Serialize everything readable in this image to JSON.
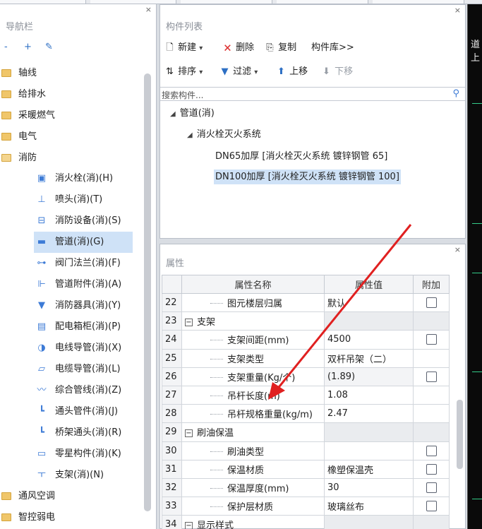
{
  "nav": {
    "title": "导航栏",
    "close": "×",
    "toolbar": [
      "-",
      "+",
      "✎"
    ],
    "categories": [
      {
        "label": "轴线"
      },
      {
        "label": "给排水"
      },
      {
        "label": "采暖燃气"
      },
      {
        "label": "电气"
      },
      {
        "label": "消防"
      }
    ],
    "fire_items": [
      {
        "label": "消火栓(消)(H)",
        "icon": "hydrant-icon",
        "glyph": "▣"
      },
      {
        "label": "喷头(消)(T)",
        "icon": "sprinkler-icon",
        "glyph": "⊥"
      },
      {
        "label": "消防设备(消)(S)",
        "icon": "fire-equipment-icon",
        "glyph": "⊟"
      },
      {
        "label": "管道(消)(G)",
        "icon": "pipe-icon",
        "glyph": "▬"
      },
      {
        "label": "阀门法兰(消)(F)",
        "icon": "valve-icon",
        "glyph": "⊶"
      },
      {
        "label": "管道附件(消)(A)",
        "icon": "pipe-fitting-icon",
        "glyph": "⊩"
      },
      {
        "label": "消防器具(消)(Y)",
        "icon": "fire-appliance-icon",
        "glyph": "▼"
      },
      {
        "label": "配电箱柜(消)(P)",
        "icon": "distribution-box-icon",
        "glyph": "▤"
      },
      {
        "label": "电线导管(消)(X)",
        "icon": "wire-conduit-icon",
        "glyph": "◑"
      },
      {
        "label": "电缆导管(消)(L)",
        "icon": "cable-conduit-icon",
        "glyph": "▱"
      },
      {
        "label": "综合管线(消)(Z)",
        "icon": "pipeline-icon",
        "glyph": "〰"
      },
      {
        "label": "通头管件(消)(J)",
        "icon": "tee-fitting-icon",
        "glyph": "┗"
      },
      {
        "label": "桥架通头(消)(R)",
        "icon": "tray-tee-icon",
        "glyph": "┗"
      },
      {
        "label": "零星构件(消)(K)",
        "icon": "misc-component-icon",
        "glyph": "▭"
      },
      {
        "label": "支架(消)(N)",
        "icon": "support-icon",
        "glyph": "ㅜ"
      }
    ],
    "bottom_categories": [
      {
        "label": "通风空调"
      },
      {
        "label": "智控弱电"
      }
    ]
  },
  "complist": {
    "title": "构件列表",
    "close": "×",
    "toolbar1": {
      "new": "新建",
      "delete": "删除",
      "copy": "复制",
      "library": "构件库>>"
    },
    "toolbar2": {
      "sort": "排序",
      "filter": "过滤",
      "up": "上移",
      "down": "下移"
    },
    "search_placeholder": "搜索构件...",
    "tree": {
      "root": "管道(消)",
      "system": "消火栓灭火系统",
      "items": [
        "DN65加厚 [消火栓灭火系统 镀锌钢管 65]",
        "DN100加厚 [消火栓灭火系统 镀锌钢管 100]"
      ],
      "selected_index": 1
    }
  },
  "props": {
    "title": "属性",
    "close": "×",
    "headers": [
      "属性名称",
      "属性值",
      "附加"
    ],
    "rows": [
      {
        "n": "22",
        "name": "图元楼层归属",
        "value": "默认",
        "kind": "child",
        "check": true
      },
      {
        "n": "23",
        "name": "支架",
        "value": "",
        "kind": "group",
        "check": false
      },
      {
        "n": "24",
        "name": "支架间距(mm)",
        "value": "4500",
        "kind": "child",
        "check": true
      },
      {
        "n": "25",
        "name": "支架类型",
        "value": "双杆吊架（二）",
        "kind": "child",
        "check": false
      },
      {
        "n": "26",
        "name": "支架重量(Kg/个)",
        "value": "(1.89)",
        "kind": "child",
        "check": true
      },
      {
        "n": "27",
        "name": "吊杆长度(m)",
        "value": "1.08",
        "kind": "child",
        "check": false
      },
      {
        "n": "28",
        "name": "吊杆规格重量(kg/m)",
        "value": "2.47",
        "kind": "child",
        "check": false
      },
      {
        "n": "29",
        "name": "刷油保温",
        "value": "",
        "kind": "group",
        "check": false
      },
      {
        "n": "30",
        "name": "刷油类型",
        "value": "",
        "kind": "child",
        "check": true
      },
      {
        "n": "31",
        "name": "保温材质",
        "value": "橡塑保温壳",
        "kind": "child",
        "check": true
      },
      {
        "n": "32",
        "name": "保温厚度(mm)",
        "value": "30",
        "kind": "child",
        "check": true
      },
      {
        "n": "33",
        "name": "保护层材质",
        "value": "玻璃丝布",
        "kind": "child",
        "check": true
      },
      {
        "n": "34",
        "name": "显示样式",
        "value": "",
        "kind": "group",
        "check": false
      }
    ]
  },
  "canvas": {
    "text": "道上"
  },
  "colors": {
    "accent": "#3d7bd6",
    "selected": "#cfe2f7",
    "annotation_arrow": "#e02020"
  }
}
